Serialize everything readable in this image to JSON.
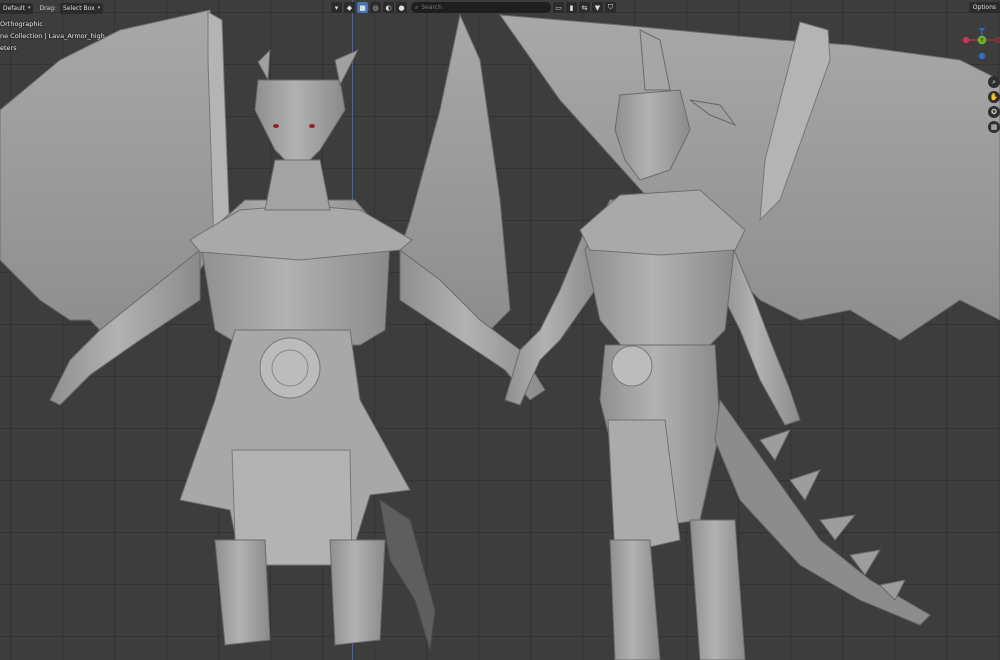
{
  "header": {
    "mode_label": "Default",
    "drag_label": "Drag:",
    "drag_value": "Select Box",
    "search_placeholder": "Search",
    "options_label": "Options"
  },
  "overlay": {
    "view_name": "Orthographic",
    "collection": "ne Collection | Lava_Armor_high",
    "units": "eters"
  },
  "colors": {
    "viewport_bg": "#3d3d3d",
    "grid": "#333333",
    "axis_blue": "#4a63a8",
    "active_tool": "#4772b3",
    "gizmo_x": "#c8374b",
    "gizmo_y": "#70b32a",
    "gizmo_z": "#2d6fc7"
  },
  "icons": {
    "viewport_shading": [
      "wireframe-icon",
      "solid-icon",
      "material-icon",
      "rendered-icon"
    ],
    "gizmos": [
      "search-icon",
      "bookmark-icon",
      "overlay-icon",
      "filter-icon",
      "shield-icon"
    ],
    "nav": [
      "zoom-icon",
      "hand-icon",
      "camera-icon",
      "grid-icon"
    ]
  },
  "gizmo": {
    "y_label": "Y"
  }
}
